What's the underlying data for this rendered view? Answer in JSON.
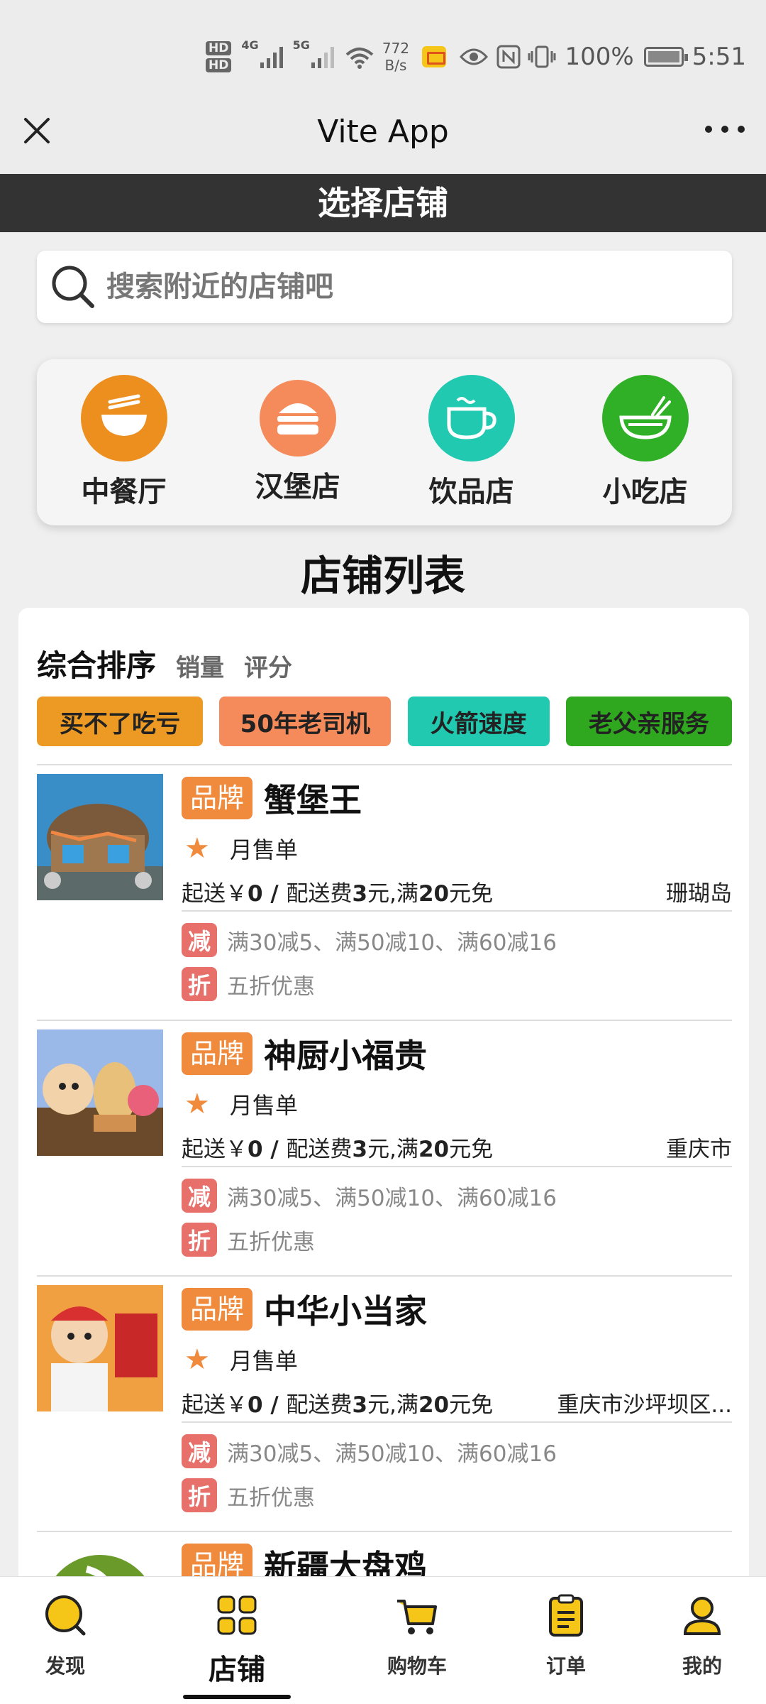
{
  "status_bar": {
    "hd1": "HD",
    "hd2": "HD",
    "net1": "4G",
    "net2": "5G",
    "speed_value": "772",
    "speed_unit": "B/s",
    "battery": "100%",
    "time": "5:51"
  },
  "title_bar": {
    "title": "Vite App"
  },
  "page_header": {
    "title": "选择店铺"
  },
  "search": {
    "placeholder": "搜索附近的店铺吧"
  },
  "categories": [
    {
      "label": "中餐厅",
      "color": "#ec8f1f",
      "icon": "bowl-icon"
    },
    {
      "label": "汉堡店",
      "color": "#f58a5a",
      "icon": "burger-icon"
    },
    {
      "label": "饮品店",
      "color": "#22c9b1",
      "icon": "cup-icon"
    },
    {
      "label": "小吃店",
      "color": "#2fb027",
      "icon": "noodle-bowl-icon"
    }
  ],
  "list_title": "店铺列表",
  "sort": {
    "active": "综合排序",
    "sales": "销量",
    "rating": "评分"
  },
  "tags": [
    {
      "label": "买不了吃亏",
      "color": "#ec9a24"
    },
    {
      "label": "50年老司机",
      "color": "#f58a5a"
    },
    {
      "label": "火箭速度",
      "color": "#22c9b1"
    },
    {
      "label": "老父亲服务",
      "color": "#2fa81f"
    }
  ],
  "shops": [
    {
      "brand": "品牌",
      "name": "蟹堡王",
      "monthly": "月售单",
      "start_prefix": "起送￥",
      "start_value": "0",
      "slash": " / ",
      "delivery_prefix": "配送费",
      "delivery_value": "3",
      "delivery_mid": "元,满",
      "free_value": "20",
      "free_suffix": "元免",
      "address": "珊瑚岛",
      "promo1_badge": "减",
      "promo1": "满30减5、满50减10、满60减16",
      "promo2_badge": "折",
      "promo2": "五折优惠"
    },
    {
      "brand": "品牌",
      "name": "神厨小福贵",
      "monthly": "月售单",
      "start_prefix": "起送￥",
      "start_value": "0",
      "slash": " / ",
      "delivery_prefix": "配送费",
      "delivery_value": "3",
      "delivery_mid": "元,满",
      "free_value": "20",
      "free_suffix": "元免",
      "address": "重庆市",
      "promo1_badge": "减",
      "promo1": "满30减5、满50减10、满60减16",
      "promo2_badge": "折",
      "promo2": "五折优惠"
    },
    {
      "brand": "品牌",
      "name": "中华小当家",
      "monthly": "月售单",
      "start_prefix": "起送￥",
      "start_value": "0",
      "slash": " / ",
      "delivery_prefix": "配送费",
      "delivery_value": "3",
      "delivery_mid": "元,满",
      "free_value": "20",
      "free_suffix": "元免",
      "address": "重庆市沙坪坝区...",
      "promo1_badge": "减",
      "promo1": "满30减5、满50减10、满60减16",
      "promo2_badge": "折",
      "promo2": "五折优惠"
    },
    {
      "brand": "品牌",
      "name": "新疆大盘鸡"
    }
  ],
  "bottom_nav": [
    {
      "label": "发现",
      "icon": "discover-icon"
    },
    {
      "label": "店铺",
      "icon": "shop-grid-icon",
      "active": true
    },
    {
      "label": "购物车",
      "icon": "cart-icon"
    },
    {
      "label": "订单",
      "icon": "order-icon"
    },
    {
      "label": "我的",
      "icon": "profile-icon"
    }
  ],
  "colors": {
    "accent": "#f08a3c",
    "promo_badge": "#e8706a",
    "header_bg": "#333333"
  }
}
